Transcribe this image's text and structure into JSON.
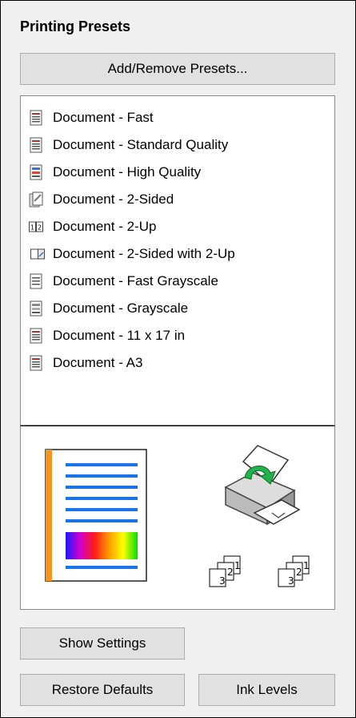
{
  "panel": {
    "title": "Printing Presets",
    "add_remove_button": "Add/Remove Presets...",
    "presets": [
      {
        "label": "Document - Fast",
        "icon": "document-fast-icon"
      },
      {
        "label": "Document - Standard Quality",
        "icon": "document-standard-icon"
      },
      {
        "label": "Document - High Quality",
        "icon": "document-high-quality-icon"
      },
      {
        "label": "Document - 2-Sided",
        "icon": "document-2-sided-icon"
      },
      {
        "label": "Document - 2-Up",
        "icon": "document-2-up-icon"
      },
      {
        "label": "Document - 2-Sided with 2-Up",
        "icon": "document-2-sided-2-up-icon"
      },
      {
        "label": "Document - Fast Grayscale",
        "icon": "document-fast-grayscale-icon"
      },
      {
        "label": "Document - Grayscale",
        "icon": "document-grayscale-icon"
      },
      {
        "label": "Document - 11 x 17 in",
        "icon": "document-11x17-icon"
      },
      {
        "label": "Document - A3",
        "icon": "document-a3-icon"
      }
    ],
    "collate_labels": {
      "left": [
        "1",
        "2",
        "3"
      ],
      "right": [
        "1",
        "2",
        "3"
      ]
    },
    "show_settings_button": "Show Settings",
    "restore_defaults_button": "Restore Defaults",
    "ink_levels_button": "Ink Levels"
  },
  "colors": {
    "accent_orange": "#f7941d",
    "preview_blue": "#1a73e8",
    "arrow_green": "#22b14c"
  }
}
